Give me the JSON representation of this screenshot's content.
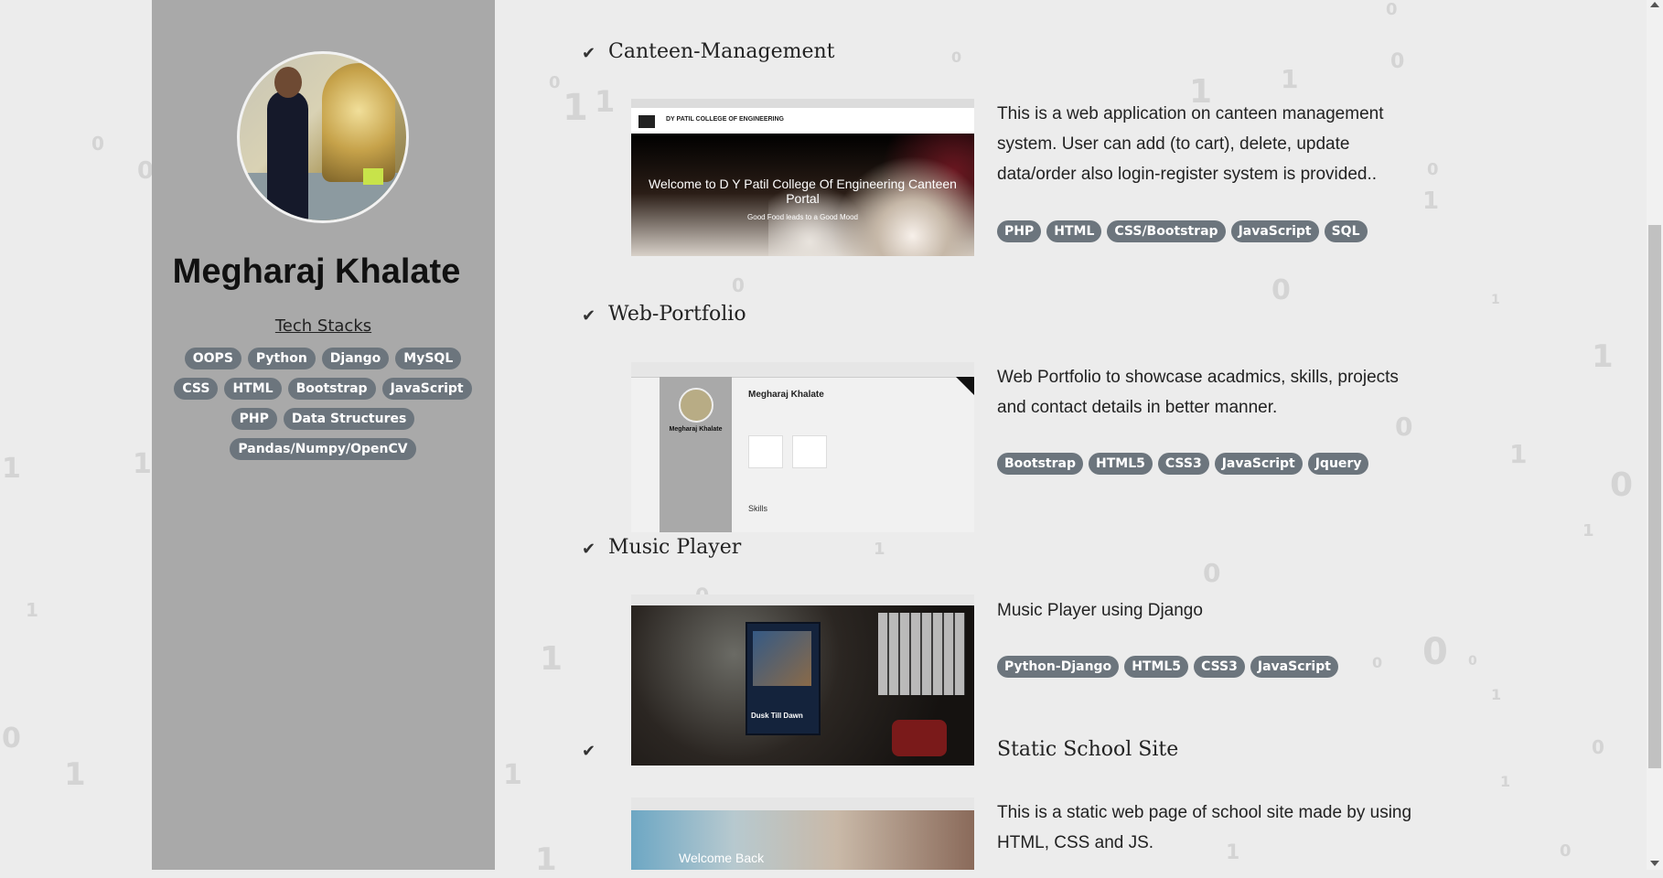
{
  "sidebar": {
    "name": "Megharaj Khalate",
    "tech_title": "Tech Stacks",
    "tech_stacks": [
      "OOPS",
      "Python",
      "Django",
      "MySQL",
      "CSS",
      "HTML",
      "Bootstrap",
      "JavaScript",
      "PHP",
      "Data Structures",
      "Pandas/Numpy/OpenCV"
    ]
  },
  "projects": [
    {
      "title": "Canteen-Management",
      "description": "This is a web application on canteen management system. User can add (to cart), delete, update data/order also login-register system is provided..",
      "tags": [
        "PHP",
        "HTML",
        "CSS/Bootstrap",
        "JavaScript",
        "SQL"
      ],
      "screenshot": {
        "header": "DY PATIL COLLEGE OF ENGINEERING",
        "headline": "Welcome to D Y Patil College Of Engineering Canteen Portal",
        "subline": "Good Food leads to a Good Mood"
      }
    },
    {
      "title": "Web-Portfolio",
      "description": "Web Portfolio to showcase acadmics, skills, projects and contact details in better manner.",
      "tags": [
        "Bootstrap",
        "HTML5",
        "CSS3",
        "JavaScript",
        "Jquery"
      ],
      "screenshot": {
        "side_name": "Megharaj Khalate",
        "heading": "Megharaj Khalate",
        "section": "Skills"
      }
    },
    {
      "title": "Music Player",
      "description": "Music Player using Django",
      "tags": [
        "Python-Django",
        "HTML5",
        "CSS3",
        "JavaScript"
      ],
      "screenshot": {
        "song": "Dusk Till Dawn"
      }
    },
    {
      "title": "Static School Site",
      "description": "This is a static web page of school site made by using HTML, CSS and JS.",
      "tags": [],
      "screenshot": {
        "headline": "Welcome Back"
      }
    }
  ],
  "background_digits": [
    "0",
    "1"
  ],
  "colors": {
    "sidebar": "#a9a9a9",
    "page": "#ececec",
    "badge": "#6c757d"
  }
}
